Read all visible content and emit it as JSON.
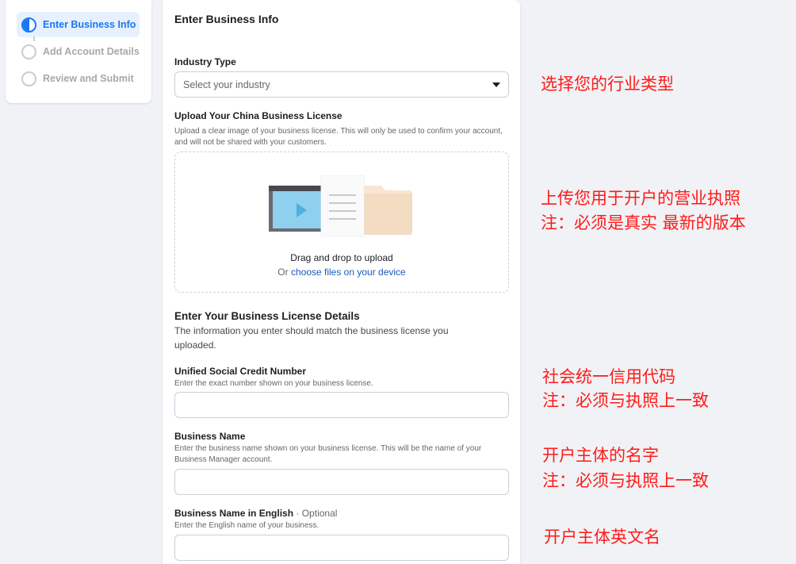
{
  "steps": [
    {
      "label": "Enter Business Info",
      "active": true
    },
    {
      "label": "Add Account Details",
      "active": false
    },
    {
      "label": "Review and Submit",
      "active": false
    }
  ],
  "form": {
    "title": "Enter Business Info",
    "industry": {
      "label": "Industry Type",
      "placeholder": "Select your industry"
    },
    "license_upload": {
      "label": "Upload Your China Business License",
      "hint": "Upload a clear image of your business license. This will only be used to confirm your account, and will not be shared with your customers.",
      "drag_text": "Drag and drop to upload",
      "or_text": "Or",
      "choose_link": "choose files on your device"
    },
    "details_section": {
      "title": "Enter Your Business License Details",
      "description": "The information you enter should match the business license you uploaded."
    },
    "credit_number": {
      "label": "Unified Social Credit Number",
      "hint": "Enter the exact number shown on your business license.",
      "value": ""
    },
    "business_name": {
      "label": "Business Name",
      "hint": "Enter the business name shown on your business license. This will be the name of your Business Manager account.",
      "value": ""
    },
    "business_name_en": {
      "label": "Business Name in English",
      "optional": "· Optional",
      "hint": "Enter the English name of your business.",
      "value": ""
    }
  },
  "annotations": {
    "industry": "选择您的行业类型",
    "license_line1": "上传您用于开户的营业执照",
    "license_line2": "注：必须是真实 最新的版本",
    "credit_line1": "社会统一信用代码",
    "credit_line2": "注：必须与执照上一致",
    "name_line1": "开户主体的名字",
    "name_line2": "注：必须与执照上一致",
    "name_en_line1": "开户主体英文名"
  },
  "colors": {
    "accent": "#1877f2",
    "annotation": "#ff1a1a",
    "page_bg": "#f0f2f5"
  }
}
